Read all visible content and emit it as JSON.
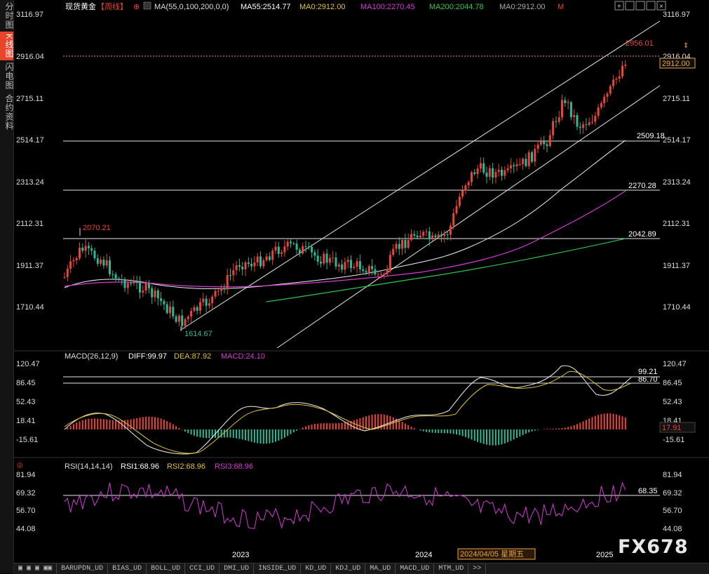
{
  "sidebar": {
    "items": [
      {
        "label": "分时图",
        "active": false
      },
      {
        "label": "K线图",
        "active": true
      },
      {
        "label": "闪电图",
        "active": false
      },
      {
        "label": "合约资料",
        "active": false
      }
    ]
  },
  "header": {
    "symbol": "现货黄金",
    "period": "【周线】",
    "ma_label": "MA(55,0,100,200,0,0)",
    "ma55": "MA55:2514.77",
    "ma0a": "MA0:2912.00",
    "ma100": "MA100:2270.45",
    "ma200": "MA200:2044.78",
    "ma0b": "MA0:2912.00",
    "m": "M",
    "icons": [
      "add-icon",
      "fullscreen-icon",
      "restore-icon",
      "tile-icon",
      "close-icon"
    ]
  },
  "price_axis": {
    "ticks": [
      "3116.97",
      "2916.04",
      "2715.11",
      "2514.17",
      "2313.24",
      "2112.31",
      "1911.37",
      "1710.44"
    ],
    "current_price": "2912.00"
  },
  "annotations": {
    "high_label": "2956.01",
    "left_high": "2070.21",
    "low_label": "1614.67",
    "line_2509": "2509.18",
    "line_2270": "2270.28",
    "line_2042": "2042.89"
  },
  "macd": {
    "title": "MACD(26,12,9)",
    "diff": "DIFF:99.97",
    "dea": "DEA:87.92",
    "macd": "MACD:24.10",
    "ticks": [
      "120.47",
      "86.45",
      "52.43",
      "18.41",
      "-15.61"
    ],
    "current": "17.91",
    "level1": "99.21",
    "level2": "86.70"
  },
  "rsi": {
    "title": "RSI(14,14,14)",
    "rsi1": "RSI1:68.96",
    "rsi2": "RSI2:68.96",
    "rsi3": "RSI3:68.96",
    "ticks": [
      "81.94",
      "69.32",
      "56.70",
      "44.08"
    ],
    "level": "68.35"
  },
  "time_axis": {
    "labels": [
      "2023",
      "2024",
      "2025"
    ],
    "cursor_label": "2024/04/05 星期五"
  },
  "indicator_tabs": [
    "BARUPDN_UD",
    "BIAS_UD",
    "BOLL_UD",
    "CCI_UD",
    "DMI_UD",
    "INSIDE_UD",
    "KD_UD",
    "KDJ_UD",
    "MA_UD",
    "MACD_UD",
    "MTM_UD",
    ">>"
  ],
  "watermark": "FX678",
  "colors": {
    "up": "#e8453c",
    "down": "#2fb894",
    "ma55": "#ffffff",
    "ma100": "#d63bd6",
    "ma200": "#2cc94b",
    "dea": "#e0c23a",
    "accent": "#e8452b"
  },
  "chart_data": {
    "type": "candlestick",
    "timeframe": "weekly",
    "price_range": [
      1620,
      3140
    ],
    "levels": [
      2514.17,
      2270.28,
      2042.89,
      2916.04
    ],
    "ma55_end": 2514.77,
    "ma100_end": 2270.45,
    "ma200_end": 2044.78
  }
}
